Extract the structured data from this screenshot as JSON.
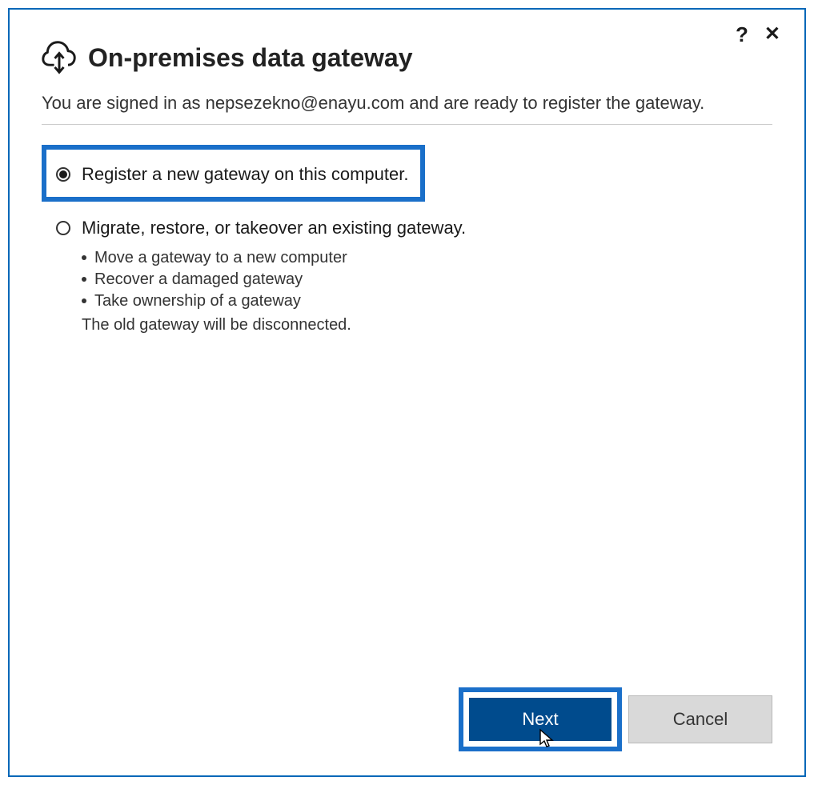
{
  "header": {
    "title": "On-premises data gateway"
  },
  "subtitle": "You are signed in as nepsezekno@enayu.com and are ready to register the gateway.",
  "options": {
    "register": {
      "label": "Register a new gateway on this computer.",
      "selected": true
    },
    "migrate": {
      "label": "Migrate, restore, or takeover an existing gateway.",
      "bullets": [
        "Move a gateway to a new computer",
        "Recover a damaged gateway",
        "Take ownership of a gateway"
      ],
      "note": "The old gateway will be disconnected.",
      "selected": false
    }
  },
  "buttons": {
    "next": "Next",
    "cancel": "Cancel"
  },
  "controls": {
    "help": "?",
    "close": "✕"
  }
}
